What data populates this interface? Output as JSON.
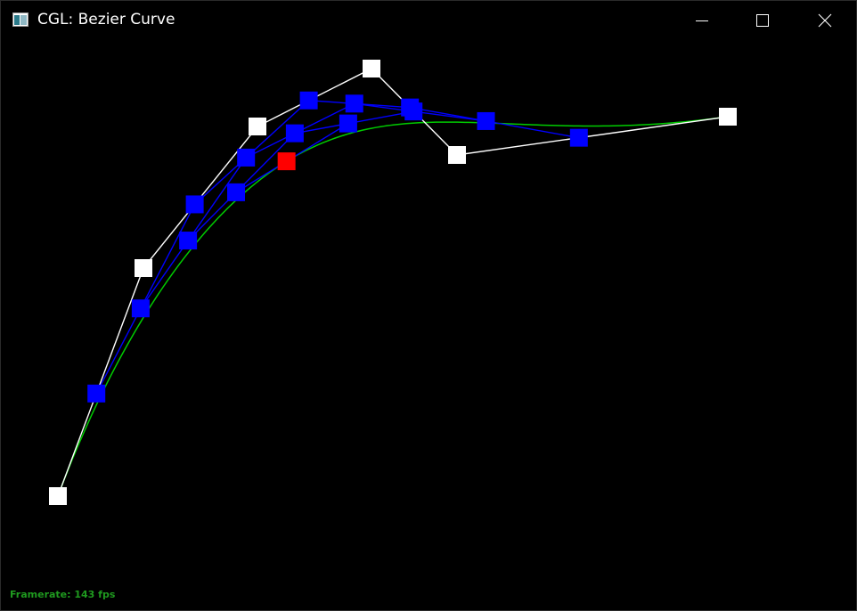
{
  "window": {
    "title": "CGL: Bezier Curve",
    "icons": {
      "app": "app-window-icon",
      "minimize": "minimize-icon",
      "maximize": "maximize-icon",
      "close": "close-icon"
    }
  },
  "status": {
    "framerate": "Framerate: 143 fps"
  },
  "colors": {
    "background": "#000000",
    "control_point": "#ffffff",
    "control_polygon": "#ffffff",
    "intermediate_point": "#0000ff",
    "intermediate_line": "#0000ff",
    "evaluated_point": "#ff0000",
    "curve": "#00cc00",
    "framerate_text": "#1f9a1f"
  }
}
